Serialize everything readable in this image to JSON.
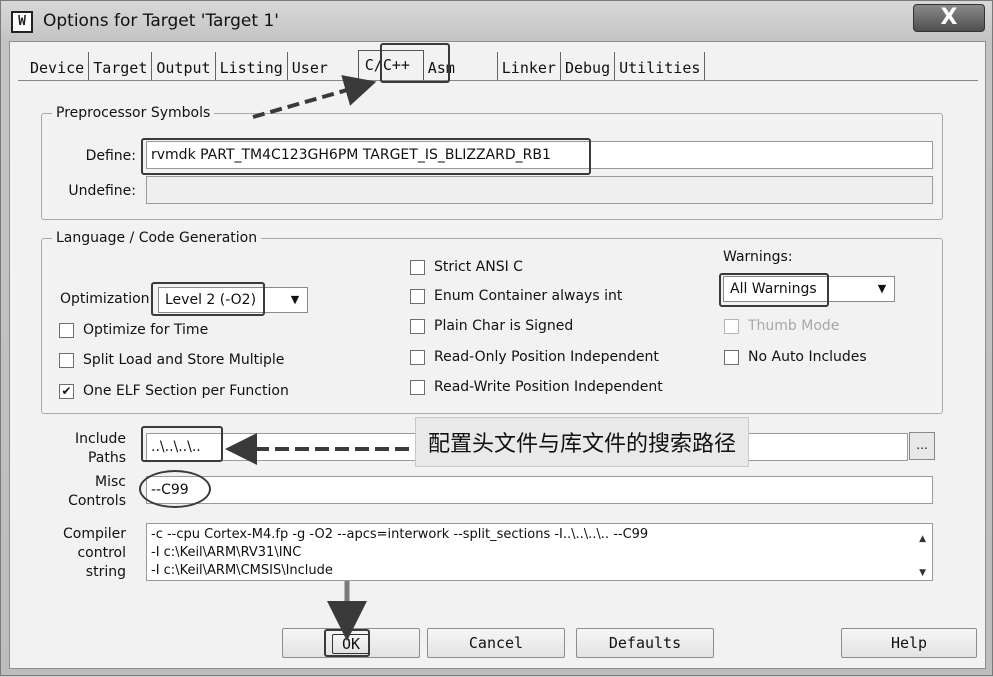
{
  "window": {
    "title": "Options for Target 'Target 1'",
    "app_icon_glyph": "W",
    "close_glyph": "X"
  },
  "tabs": [
    {
      "label": "Device"
    },
    {
      "label": "Target"
    },
    {
      "label": "Output"
    },
    {
      "label": "Listing"
    },
    {
      "label": "User"
    },
    {
      "label": "C/C++",
      "active": true
    },
    {
      "label": "Asm"
    },
    {
      "label": "Linker"
    },
    {
      "label": "Debug"
    },
    {
      "label": "Utilities"
    }
  ],
  "preprocessor": {
    "legend": "Preprocessor Symbols",
    "define_label": "Define:",
    "define_value": "rvmdk PART_TM4C123GH6PM TARGET_IS_BLIZZARD_RB1",
    "undefine_label": "Undefine:",
    "undefine_value": ""
  },
  "language": {
    "legend": "Language / Code Generation",
    "optimization_label": "Optimization:",
    "optimization_value": "Level 2 (-O2)",
    "left_checks": [
      {
        "label": "Optimize for Time",
        "checked": false
      },
      {
        "label": "Split Load and Store Multiple",
        "checked": false
      },
      {
        "label": "One ELF Section per Function",
        "checked": true
      }
    ],
    "middle_checks": [
      {
        "label": "Strict ANSI C",
        "checked": false
      },
      {
        "label": "Enum Container always int",
        "checked": false
      },
      {
        "label": "Plain Char is Signed",
        "checked": false
      },
      {
        "label": "Read-Only Position Independent",
        "checked": false
      },
      {
        "label": "Read-Write Position Independent",
        "checked": false
      }
    ],
    "warnings_label": "Warnings:",
    "warnings_value": "All Warnings",
    "thumb_mode_label": "Thumb Mode",
    "no_auto_includes_label": "No Auto Includes"
  },
  "include": {
    "label_line1": "Include",
    "label_line2": "Paths",
    "value": "..\\..\\..\\..",
    "browse_label": "..."
  },
  "misc": {
    "label_line1": "Misc",
    "label_line2": "Controls",
    "value": "--C99"
  },
  "compiler": {
    "label_line1": "Compiler",
    "label_line2": "control",
    "label_line3": "string",
    "lines": [
      "-c --cpu Cortex-M4.fp -g -O2 --apcs=interwork --split_sections -I..\\..\\..\\.. --C99",
      "-I c:\\Keil\\ARM\\RV31\\INC",
      "-I c:\\Keil\\ARM\\CMSIS\\Include"
    ]
  },
  "annotation": {
    "callout_text": "配置头文件与库文件的搜索路径"
  },
  "buttons": {
    "ok": "OK",
    "cancel": "Cancel",
    "defaults": "Defaults",
    "help": "Help"
  }
}
